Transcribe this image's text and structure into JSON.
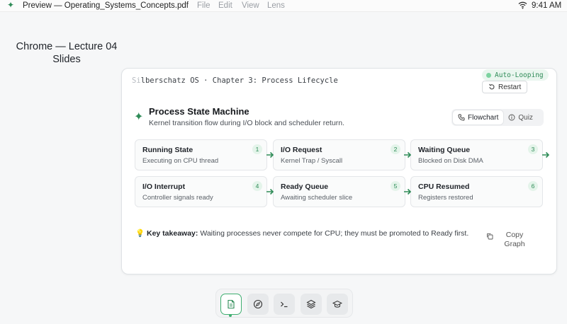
{
  "menubar": {
    "app_icon": "sparkle-icon",
    "title": "Preview — Operating_Systems_Concepts.pdf",
    "menus": [
      "File",
      "Edit",
      "View",
      "Lens"
    ],
    "clock": "9:41 AM"
  },
  "window_label": "Chrome — Lecture 04 Slides",
  "card": {
    "header_blur": "Si",
    "header_title": "lberschatz OS · Chapter 3: Process Lifecycle",
    "status_badge": "Auto-Looping",
    "restart_label": "Restart",
    "title": "Process State Machine",
    "subtitle": "Kernel transition flow during I/O block and scheduler return.",
    "view_toggle": {
      "flowchart": "Flowchart",
      "quiz": "Quiz",
      "selected": "Flowchart"
    },
    "steps": [
      {
        "num": "1",
        "title": "Running State",
        "sub": "Executing on CPU thread"
      },
      {
        "num": "2",
        "title": "I/O Request",
        "sub": "Kernel Trap / Syscall"
      },
      {
        "num": "3",
        "title": "Waiting Queue",
        "sub": "Blocked on Disk DMA"
      },
      {
        "num": "4",
        "title": "I/O Interrupt",
        "sub": "Controller signals ready"
      },
      {
        "num": "5",
        "title": "Ready Queue",
        "sub": "Awaiting scheduler slice"
      },
      {
        "num": "6",
        "title": "CPU Resumed",
        "sub": "Registers restored"
      }
    ],
    "takeaway_label": "Key takeaway:",
    "takeaway_text": "Waiting processes never compete for CPU; they must be promoted to Ready first.",
    "copy_label": "Copy Graph"
  },
  "dock": [
    "document-icon",
    "compass-icon",
    "terminal-icon",
    "layers-icon",
    "graduation-cap-icon"
  ],
  "colors": {
    "accent": "#2e8b57",
    "accent_light": "#e4f4ea"
  }
}
